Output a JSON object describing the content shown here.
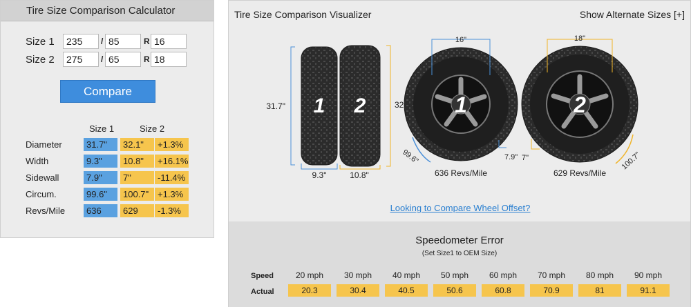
{
  "calculator": {
    "title": "Tire Size Comparison Calculator",
    "size1": {
      "label": "Size 1",
      "width": "235",
      "ratio": "85",
      "rim": "16"
    },
    "size2": {
      "label": "Size 2",
      "width": "275",
      "ratio": "65",
      "rim": "18"
    },
    "sep_slash": "/",
    "sep_rim": "R",
    "compare_label": "Compare",
    "col_size1": "Size 1",
    "col_size2": "Size 2",
    "rows": [
      {
        "label": "Diameter",
        "s1": "31.7\"",
        "s2": "32.1\"",
        "diff": "+1.3%"
      },
      {
        "label": "Width",
        "s1": "9.3\"",
        "s2": "10.8\"",
        "diff": "+16.1%"
      },
      {
        "label": "Sidewall",
        "s1": "7.9\"",
        "s2": "7\"",
        "diff": "-11.4%"
      },
      {
        "label": "Circum.",
        "s1": "99.6\"",
        "s2": "100.7\"",
        "diff": "+1.3%"
      },
      {
        "label": "Revs/Mile",
        "s1": "636",
        "s2": "629",
        "diff": "-1.3%"
      }
    ]
  },
  "visualizer": {
    "title": "Tire Size Comparison Visualizer",
    "alternate_label": "Show Alternate Sizes [+]",
    "tire1_number": "1",
    "tire2_number": "2",
    "height1": "31.7\"",
    "height2": "32.1\"",
    "width1": "9.3\"",
    "width2": "10.8\"",
    "rim1": "16\"",
    "rim2": "18\"",
    "sidewall1": "7.9\"",
    "sidewall2": "7\"",
    "circ1": "99.6\"",
    "circ2": "100.7\"",
    "revs1": "636 Revs/Mile",
    "revs2": "629 Revs/Mile",
    "offset_link": "Looking to Compare Wheel Offset?",
    "colors": {
      "tire1": "#4a90d9",
      "tire2": "#f0b429"
    }
  },
  "speedometer": {
    "title": "Speedometer Error",
    "subtitle": "(Set Size1 to OEM Size)",
    "speed_label": "Speed",
    "actual_label": "Actual",
    "speeds": [
      "20 mph",
      "30 mph",
      "40 mph",
      "50 mph",
      "60 mph",
      "70 mph",
      "80 mph",
      "90 mph"
    ],
    "actuals": [
      "20.3",
      "30.4",
      "40.5",
      "50.6",
      "60.8",
      "70.9",
      "81",
      "91.1"
    ]
  }
}
